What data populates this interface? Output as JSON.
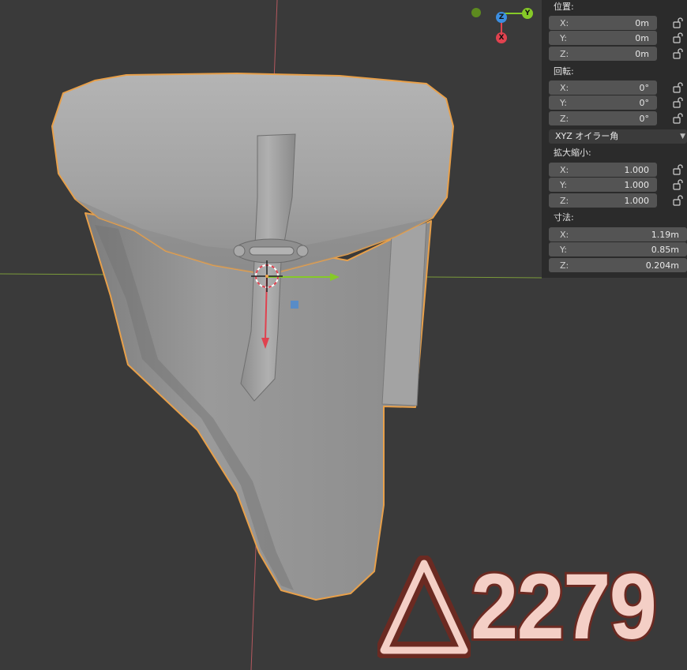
{
  "transform_panel": {
    "location": {
      "label": "位置:",
      "fields": [
        {
          "axis": "X:",
          "value": "0m"
        },
        {
          "axis": "Y:",
          "value": "0m"
        },
        {
          "axis": "Z:",
          "value": "0m"
        }
      ]
    },
    "rotation": {
      "label": "回転:",
      "fields": [
        {
          "axis": "X:",
          "value": "0°"
        },
        {
          "axis": "Y:",
          "value": "0°"
        },
        {
          "axis": "Z:",
          "value": "0°"
        }
      ],
      "mode": "XYZ オイラー角"
    },
    "scale": {
      "label": "拡大縮小:",
      "fields": [
        {
          "axis": "X:",
          "value": "1.000"
        },
        {
          "axis": "Y:",
          "value": "1.000"
        },
        {
          "axis": "Z:",
          "value": "1.000"
        }
      ]
    },
    "dimensions": {
      "label": "寸法:",
      "fields": [
        {
          "axis": "X:",
          "value": "1.19m"
        },
        {
          "axis": "Y:",
          "value": "0.85m"
        },
        {
          "axis": "Z:",
          "value": "0.204m"
        }
      ]
    }
  },
  "gizmo": {
    "z": "Z",
    "y": "Y",
    "x": "X"
  },
  "watermark": {
    "text": "2279"
  },
  "colors": {
    "viewport_bg": "#3a3a3a",
    "panel_bg": "#2b2b2b",
    "selection_outline": "#e8a04a",
    "axis_x": "#e0424f",
    "axis_y": "#86c928",
    "axis_z": "#3c8ee0"
  }
}
